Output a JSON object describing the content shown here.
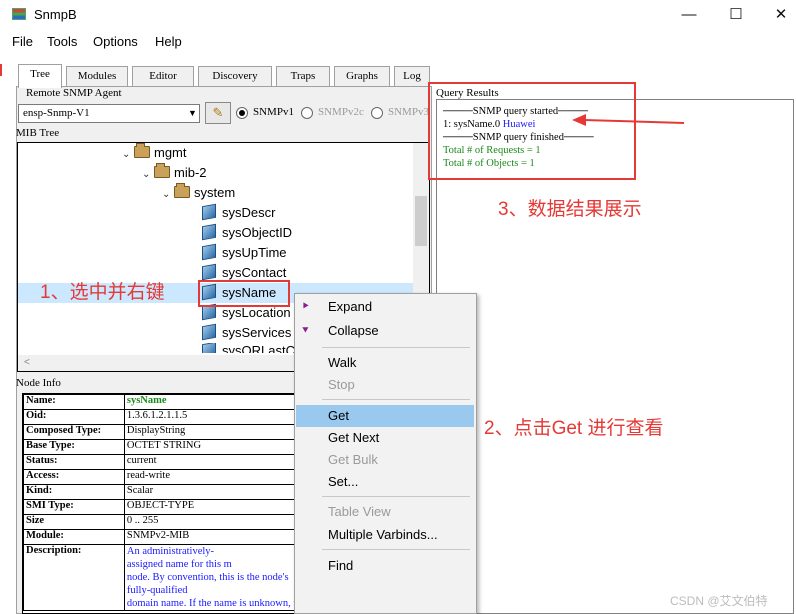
{
  "window": {
    "title": "SnmpB",
    "minimize": "—",
    "maximize": "☐",
    "close": "✕"
  },
  "menu": [
    "File",
    "Tools",
    "Options",
    "Help"
  ],
  "tabs": [
    "Tree",
    "Modules",
    "Editor",
    "Discovery",
    "Traps",
    "Graphs",
    "Log"
  ],
  "agent": {
    "label": "Remote SNMP Agent",
    "selected": "ensp-Snmp-V1",
    "versions": [
      "SNMPv1",
      "SNMPv2c",
      "SNMPv3"
    ]
  },
  "mib_tree": {
    "label": "MIB Tree",
    "rows": [
      "mgmt",
      "mib-2",
      "system",
      "sysDescr",
      "sysObjectID",
      "sysUpTime",
      "sysContact",
      "sysName",
      "sysLocation",
      "sysServices",
      "sysORLastC"
    ]
  },
  "node_info": {
    "label": "Node Info",
    "rows": [
      {
        "k": "Name:",
        "v": "sysName"
      },
      {
        "k": "Oid:",
        "v": "1.3.6.1.2.1.1.5"
      },
      {
        "k": "Composed Type:",
        "v": "DisplayString"
      },
      {
        "k": "Base Type:",
        "v": "OCTET STRING"
      },
      {
        "k": "Status:",
        "v": "current"
      },
      {
        "k": "Access:",
        "v": "read-write"
      },
      {
        "k": "Kind:",
        "v": "Scalar"
      },
      {
        "k": "SMI Type:",
        "v": "OBJECT-TYPE"
      },
      {
        "k": "Size",
        "v": "0 .. 255"
      },
      {
        "k": "Module:",
        "v": "SNMPv2-MIB"
      },
      {
        "k": "Description:",
        "v": "An  administratively-"
      }
    ],
    "description_lines": [
      "assigned  name  for  this  m",
      "node.    By  convention,  this  is  the  node's",
      "   fully-qualified",
      "domain  name.    If  the  name  is  unknown,  t"
    ]
  },
  "query_results": {
    "label": "Query Results",
    "started": "SNMP query started",
    "result_prefix": "1: sysName.0 ",
    "result_value": "Huawei",
    "finished": "SNMP query finished",
    "requests": "Total # of Requests = 1",
    "objects": "Total # of Objects = 1"
  },
  "context_menu": {
    "expand": "Expand",
    "collapse": "Collapse",
    "walk": "Walk",
    "stop": "Stop",
    "get": "Get",
    "get_next": "Get Next",
    "get_bulk": "Get Bulk",
    "set": "Set...",
    "table_view": "Table View",
    "multiple_varbinds": "Multiple Varbinds...",
    "find": "Find"
  },
  "annotations": {
    "step1": "1、选中并右键",
    "step2": "2、点击Get 进行查看",
    "step3": "3、数据结果展示"
  },
  "watermark": "CSDN @艾文伯特",
  "colors": {
    "annotation": "#e53935",
    "highlight": "#99c9ef",
    "result_blue": "#1a1aff",
    "total_green": "#1a8a1a"
  }
}
